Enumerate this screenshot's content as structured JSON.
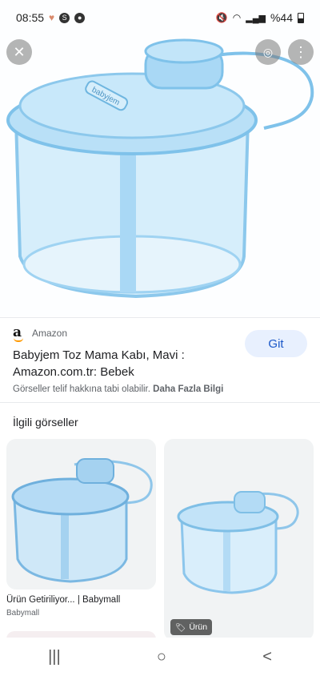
{
  "status": {
    "time": "08:55",
    "left_icons": [
      "heart-icon",
      "app-icon-s",
      "app-icon-chat"
    ],
    "right_icons": [
      "mute-icon",
      "wifi-icon",
      "signal-icon"
    ],
    "battery": "%44"
  },
  "hero": {
    "close_icon": "close-icon",
    "lens_icon": "lens-icon",
    "more_icon": "more-vert-icon",
    "product_print": "babyjem"
  },
  "result": {
    "source": "Amazon",
    "title": "Babyjem Toz Mama Kabı, Mavi : Amazon.com.tr: Bebek",
    "visit_label": "Git",
    "copyright": "Görseller telif hakkına tabi olabilir.",
    "more_info": "Daha Fazla Bilgi"
  },
  "related": {
    "heading": "İlgili görseller",
    "cards": [
      {
        "title": "Ürün Getiriliyor... | Babymall",
        "source": "Babymall"
      },
      {
        "badge": "Ürün"
      }
    ]
  },
  "navbar": {
    "recents": "|||",
    "home": "○",
    "back": "<"
  },
  "colors": {
    "accent": "#1a57c8",
    "visit_bg": "#e8f0fe",
    "product_blue": "#9fd3f2"
  }
}
